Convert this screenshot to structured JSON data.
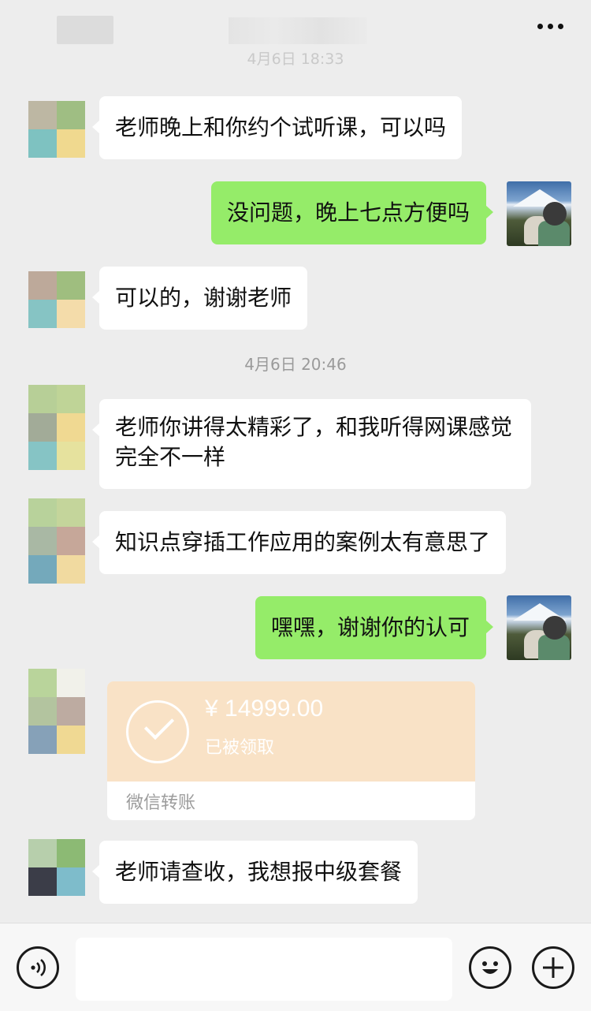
{
  "header": {
    "more_icon": "more-dots-icon",
    "ghost_timestamp": "4月6日 18:33"
  },
  "messages": [
    {
      "side": "left",
      "text": "老师晚上和你约个试听课，可以吗"
    },
    {
      "side": "right",
      "text": "没问题，晚上七点方便吗"
    },
    {
      "side": "left",
      "text": "可以的，谢谢老师"
    },
    {
      "side": "left",
      "text": "老师你讲得太精彩了，和我听得网课感觉完全不一样"
    },
    {
      "side": "left",
      "text": "知识点穿插工作应用的案例太有意思了"
    },
    {
      "side": "right",
      "text": "嘿嘿，谢谢你的认可"
    },
    {
      "side": "left",
      "text": "老师请查收，我想报中级套餐"
    }
  ],
  "timestamps": [
    "4月6日 20:46"
  ],
  "transfer": {
    "amount": "¥ 14999.00",
    "status": "已被领取",
    "footer": "微信转账",
    "icon": "check-circle-icon"
  },
  "input_bar": {
    "voice_icon": "voice-icon",
    "emoji_icon": "emoji-icon",
    "plus_icon": "plus-icon"
  },
  "colors": {
    "background": "#ededed",
    "bubble_self": "#95ec69",
    "bubble_other": "#ffffff",
    "transfer": "#f9e2c6"
  }
}
